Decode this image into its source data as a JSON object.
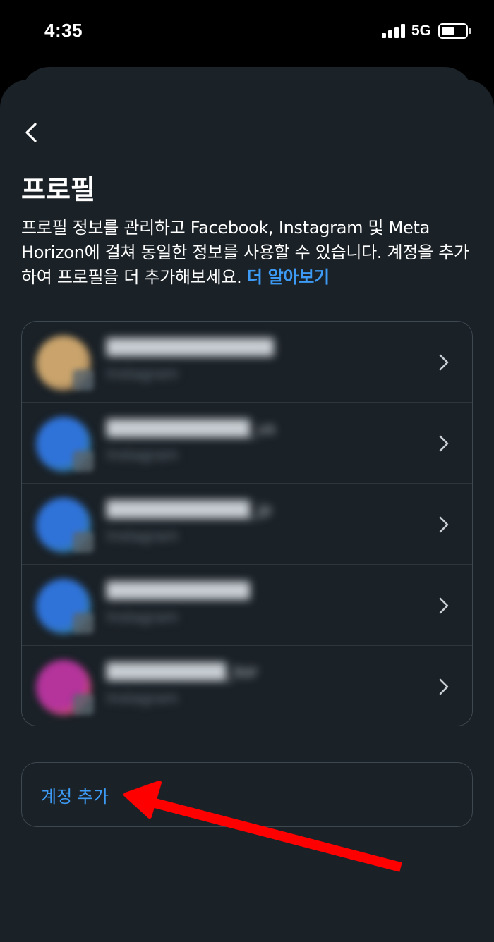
{
  "status_bar": {
    "time": "4:35",
    "network": "5G",
    "icons": [
      "signal-bars-icon",
      "battery-icon"
    ]
  },
  "header": {
    "back_icon": "chevron-left-icon",
    "title": "프로필"
  },
  "description": {
    "text": "프로필 정보를 관리하고 Facebook, Instagram 및 Meta Horizon에 걸쳐 동일한 정보를 사용할 수 있습니다. 계정을 추가하여 프로필을 더 추가해보세요.",
    "link": "더 알아보기"
  },
  "accounts": [
    {
      "name": "██████████████",
      "platform": "Instagram",
      "avatar_colors": [
        "#c9a36b",
        "#5b4a3c"
      ]
    },
    {
      "name": "████████████_us",
      "platform": "Instagram",
      "avatar_colors": [
        "#2f73d9",
        "#3f8d4a"
      ]
    },
    {
      "name": "████████████_jp",
      "platform": "Instagram",
      "avatar_colors": [
        "#2f73d9",
        "#3f8d4a"
      ]
    },
    {
      "name": "████████████",
      "platform": "Instagram",
      "avatar_colors": [
        "#2f73d9",
        "#3f8d4a"
      ]
    },
    {
      "name": "██████████_kor",
      "platform": "Instagram",
      "avatar_colors": [
        "#b4349c",
        "#f07a2a"
      ]
    }
  ],
  "add_account": {
    "label": "계정 추가"
  },
  "colors": {
    "accent": "#3d9bf5",
    "sheet_bg": "#1a2127",
    "annotation_arrow": "#ff0000"
  }
}
